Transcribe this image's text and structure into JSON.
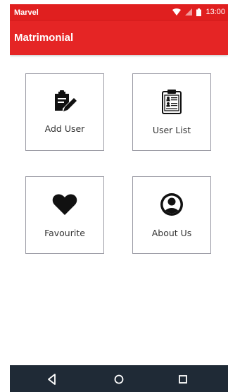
{
  "status_bar": {
    "carrier": "Marvel",
    "time": "13:00"
  },
  "app_bar": {
    "title": "Matrimonial"
  },
  "tiles": [
    {
      "label": "Add User",
      "icon": "edit-clipboard-icon"
    },
    {
      "label": "User List",
      "icon": "user-list-clipboard-icon"
    },
    {
      "label": "Favourite",
      "icon": "heart-icon"
    },
    {
      "label": "About Us",
      "icon": "account-circle-icon"
    }
  ],
  "colors": {
    "primary": "#e52525",
    "status_bar": "#e01f1f",
    "nav_bar": "#1f2a36",
    "tile_border": "#9a9aa4"
  }
}
